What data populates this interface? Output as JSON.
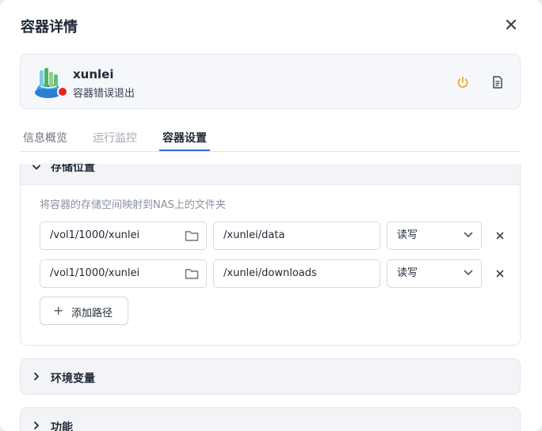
{
  "dialog": {
    "title": "容器详情"
  },
  "container": {
    "name": "xunlei",
    "status": "容器错误退出",
    "status_color": "#e8202a"
  },
  "tabs": [
    {
      "label": "信息概览",
      "state": "normal"
    },
    {
      "label": "运行监控",
      "state": "disabled"
    },
    {
      "label": "容器设置",
      "state": "active"
    }
  ],
  "storage": {
    "title": "存储位置",
    "hint": "将容器的存储空间映射到NAS上的文件夹",
    "rows": [
      {
        "host_path": "/vol1/1000/xunlei",
        "container_path": "/xunlei/data",
        "mode": "读写"
      },
      {
        "host_path": "/vol1/1000/xunlei",
        "container_path": "/xunlei/downloads",
        "mode": "读写"
      }
    ],
    "add_label": "添加路径"
  },
  "sections": [
    {
      "label": "环境变量"
    },
    {
      "label": "功能"
    }
  ],
  "colors": {
    "accent": "#2d6fd6",
    "power": "#f0a020"
  }
}
